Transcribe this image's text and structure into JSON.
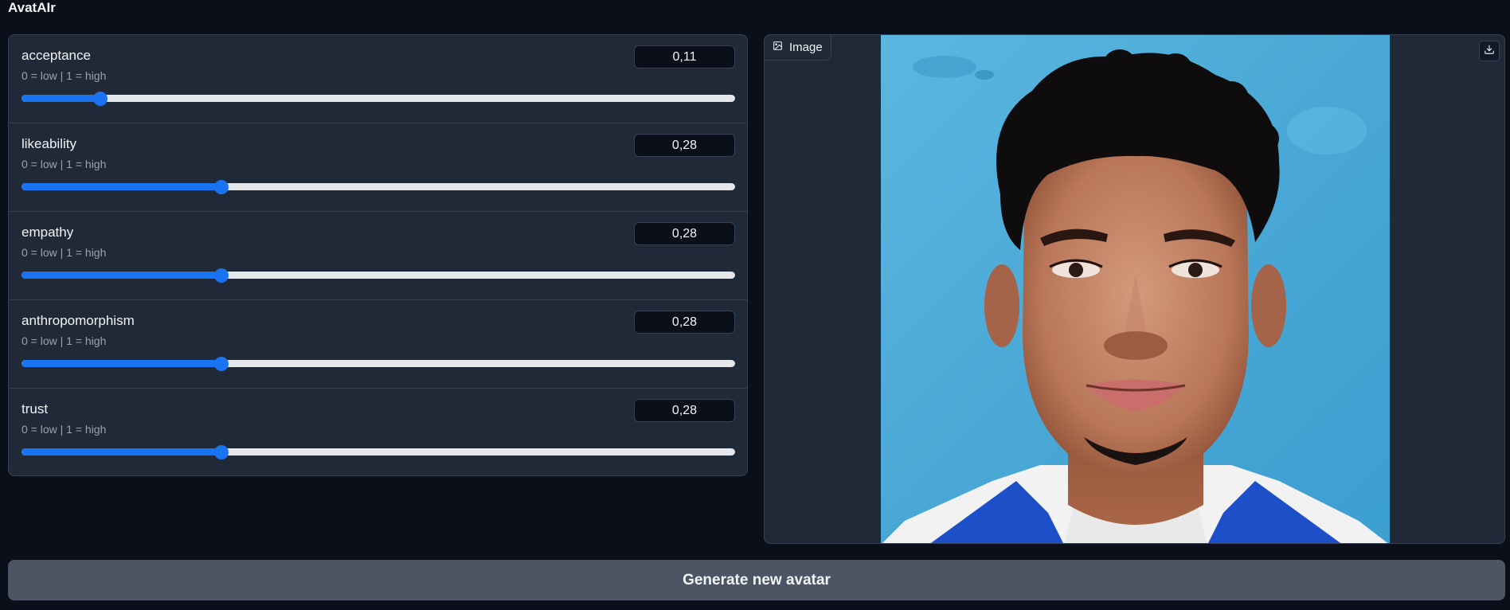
{
  "app": {
    "title": "AvatAIr"
  },
  "sliders": [
    {
      "label": "acceptance",
      "info": "0 = low | 1 = high",
      "value_text": "0,11",
      "value": 0.11
    },
    {
      "label": "likeability",
      "info": "0 = low | 1 = high",
      "value_text": "0,28",
      "value": 0.28
    },
    {
      "label": "empathy",
      "info": "0 = low | 1 = high",
      "value_text": "0,28",
      "value": 0.28
    },
    {
      "label": "anthropomorphism",
      "info": "0 = low | 1 = high",
      "value_text": "0,28",
      "value": 0.28
    },
    {
      "label": "trust",
      "info": "0 = low | 1 = high",
      "value_text": "0,28",
      "value": 0.28
    }
  ],
  "image_output": {
    "tab_label": "Image",
    "tab_icon": "image-icon",
    "download_icon": "download-icon"
  },
  "actions": {
    "generate_label": "Generate new avatar"
  },
  "colors": {
    "background": "#0b0f19",
    "panel": "#1f2937",
    "border": "#374151",
    "accent": "#1a73f0",
    "button": "#4b5563"
  }
}
